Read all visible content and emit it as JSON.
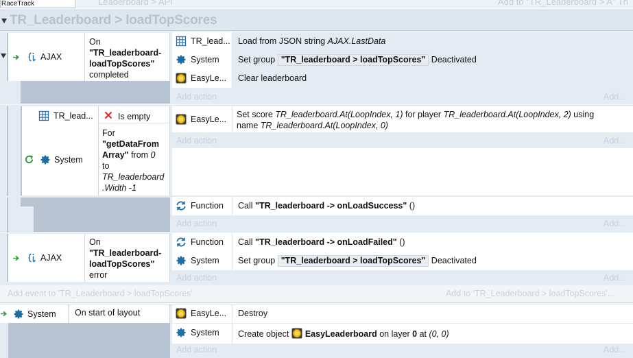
{
  "tab_racetrack": "RaceTrack",
  "topbar": {
    "left_faint": "Leaderboard > API",
    "right_faint": "Add to \"TR_Leaderboard > A\" Th"
  },
  "group_title": "TR_Leaderboard > loadTopScores",
  "event1": {
    "object": "AJAX",
    "condition": {
      "prefix": "On",
      "tag": "\"TR_leaderboard-loadTopScores\"",
      "suffix": "completed"
    },
    "actions": [
      {
        "object": "TR_lead...",
        "text": "Load from JSON string ",
        "italic": "AJAX.LastData"
      },
      {
        "object": "System",
        "prefix": "Set group ",
        "pill": "\"TR_leaderboard > loadTopScores\"",
        "suffix": " Deactivated"
      },
      {
        "object": "EasyLe...",
        "text": "Clear leaderboard"
      }
    ],
    "add_action": "Add action",
    "add_more": "Add..."
  },
  "sub1": {
    "cond1_object": "TR_lead...",
    "cond1_text": "Is empty",
    "cond2_object": "System",
    "cond2_lines": [
      "For",
      "\"getDataFrom",
      "Array\" from 0",
      "to",
      "TR_leaderboard",
      ".Width -1"
    ],
    "action_object": "EasyLe...",
    "action_line1_prefix": "Set score ",
    "action_line1_i1": "TR_leaderboard.At(LoopIndex, 1)",
    "action_line1_mid": " for player ",
    "action_line1_i2": "TR_leaderboard.At(LoopIndex, 2)",
    "action_line1_suffix": " using",
    "action_line2_prefix": "name ",
    "action_line2_i": "TR_leaderboard.At(LoopIndex, 0)",
    "add_action": "Add action",
    "add_more": "Add..."
  },
  "blank1": {
    "action_object": "Function",
    "prefix": "Call ",
    "bold": "\"TR_leaderboard -> onLoadSuccess\"",
    "suffix": " ()",
    "add_action": "Add action",
    "add_more": "Add..."
  },
  "event2": {
    "object": "AJAX",
    "condition": {
      "prefix": "On",
      "tag": "\"TR_leaderboard-loadTopScores\"",
      "suffix": "error"
    },
    "actions": [
      {
        "object": "Function",
        "prefix": "Call ",
        "bold": "\"TR_leaderboard -> onLoadFailed\"",
        "suffix": " ()"
      },
      {
        "object": "System",
        "prefix": "Set group ",
        "pill": "\"TR_leaderboard > loadTopScores\"",
        "suffix": " Deactivated"
      }
    ],
    "add_action": "Add action",
    "add_more": "Add..."
  },
  "add_event_left": "Add event to 'TR_Leaderboard > loadTopScores'",
  "add_event_right": "Add to 'TR_Leaderboard > loadTopScores'...",
  "event3": {
    "object": "System",
    "condition": "On start of layout",
    "actions": [
      {
        "object": "EasyLe...",
        "text": "Destroy"
      },
      {
        "object": "System",
        "prefix": "Create object ",
        "bold": "EasyLeaderboard",
        "mid": " on layer ",
        "bold2": "0",
        "suffix_pre": " at ",
        "italic": "(0, 0)"
      }
    ],
    "add_action": "Add action",
    "add_more": "Add..."
  },
  "colors": {
    "header_bg": "#dee6ef",
    "band": "#b8c4d2",
    "arrow_green": "#2a9a34",
    "system_blue": "#1e6ea6",
    "cross_red": "#e0262b"
  }
}
